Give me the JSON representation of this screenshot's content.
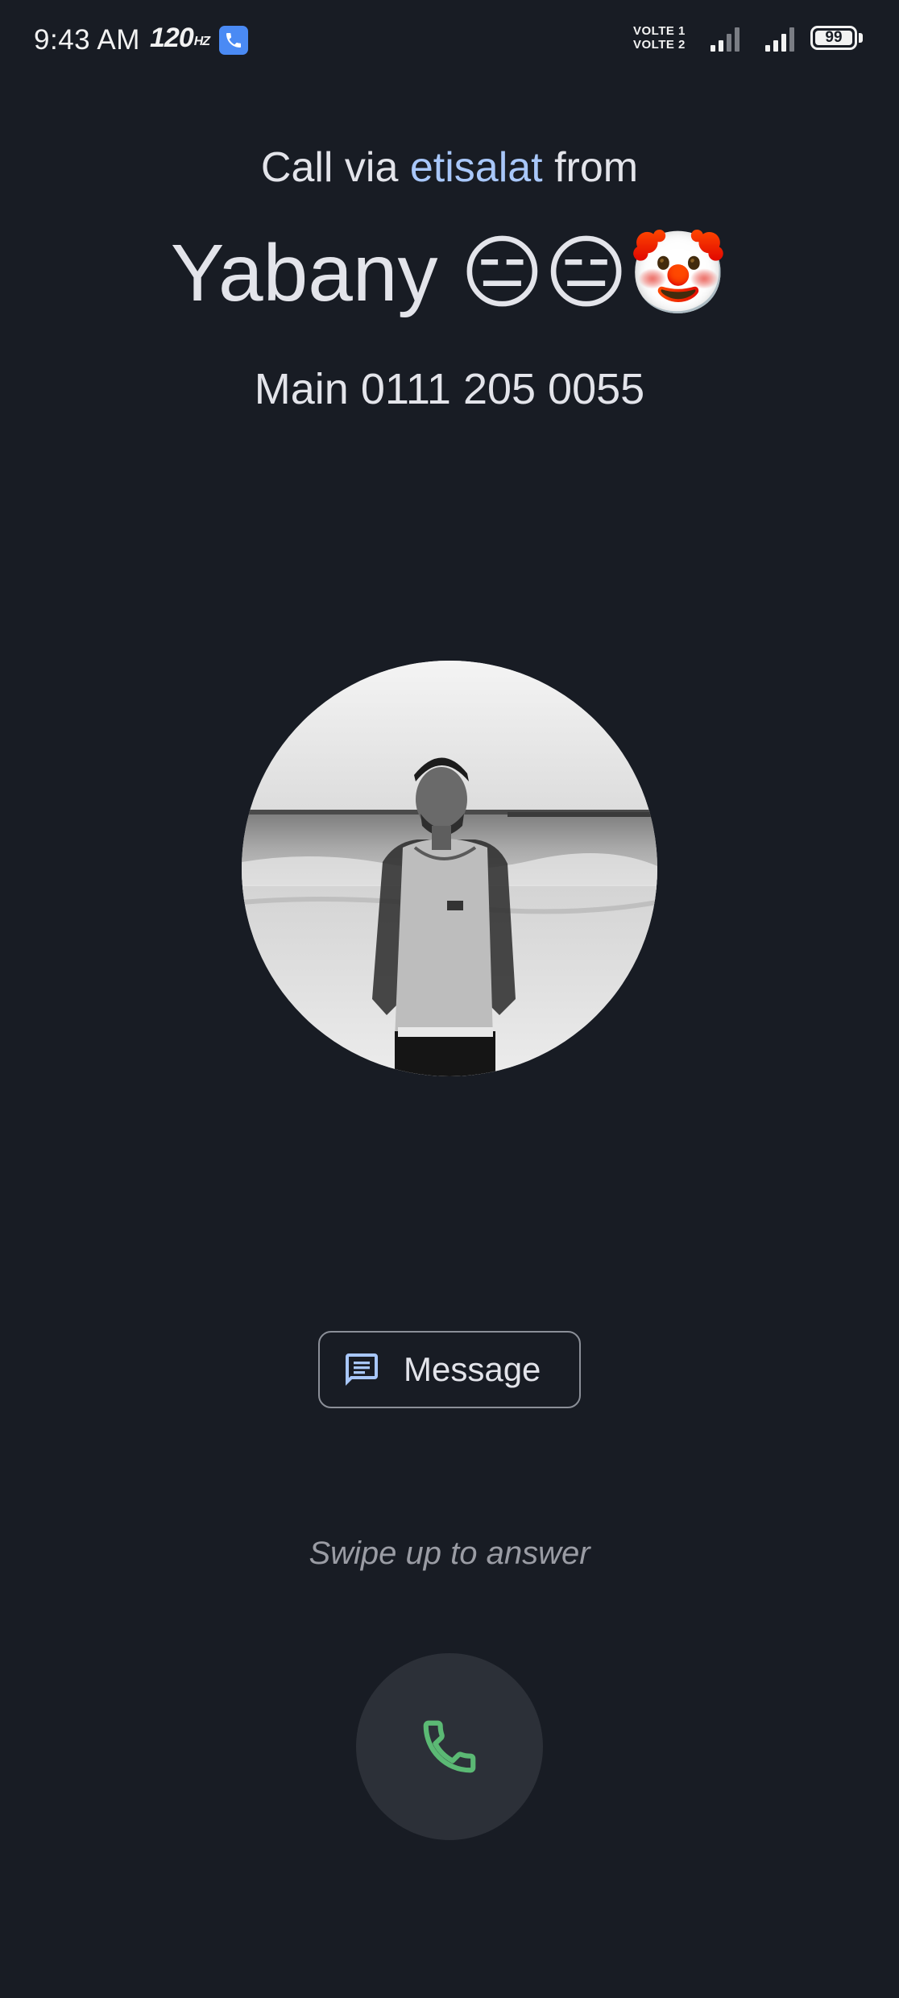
{
  "status_bar": {
    "time": "9:43 AM",
    "refresh_rate": "120",
    "refresh_unit": "HZ",
    "volte_1": "VOLTE 1",
    "volte_2": "VOLTE 2",
    "battery_level": "99",
    "notification_icon": "phone-icon",
    "accent_color": "#4a8af4"
  },
  "call": {
    "via_prefix": "Call via ",
    "carrier": "etisalat",
    "via_suffix": " from",
    "caller_name": "Yabany 😑😑🤡",
    "number_label": "Main 0111 205 0055",
    "carrier_color": "#a8c7fa"
  },
  "avatar": {
    "icon": "contact-photo"
  },
  "actions": {
    "message_label": "Message",
    "message_icon": "message-icon",
    "swipe_hint": "Swipe up to answer",
    "answer_icon": "phone-icon",
    "answer_color": "#5bb974"
  }
}
